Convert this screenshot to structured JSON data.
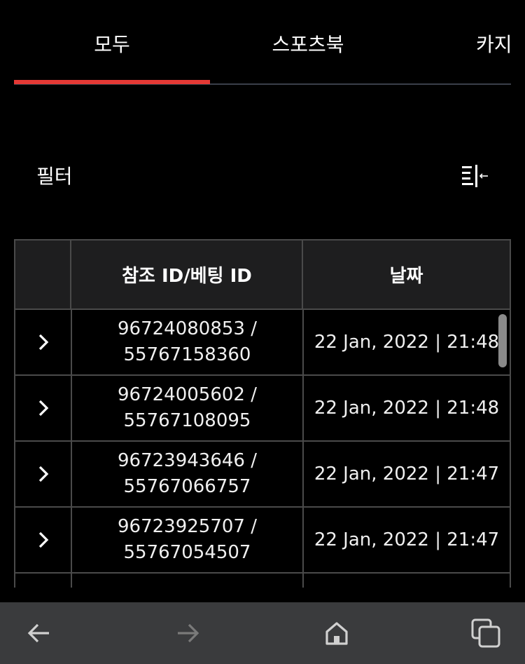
{
  "tabs": [
    {
      "label": "모두",
      "active": true
    },
    {
      "label": "스포츠북",
      "active": false
    },
    {
      "label": "카지",
      "active": false
    }
  ],
  "filter": {
    "label": "필터",
    "icon": "collapse-filter-icon"
  },
  "table": {
    "headers": {
      "expand": "",
      "ref": "참조 ID/베팅 ID",
      "date": "날짜"
    },
    "rows": [
      {
        "ref_id": "96724080853 /",
        "bet_id": "55767158360",
        "date": "22 Jan, 2022 | 21:48"
      },
      {
        "ref_id": "96724005602 /",
        "bet_id": "55767108095",
        "date": "22 Jan, 2022 | 21:48"
      },
      {
        "ref_id": "96723943646 /",
        "bet_id": "55767066757",
        "date": "22 Jan, 2022 | 21:47"
      },
      {
        "ref_id": "96723925707 /",
        "bet_id": "55767054507",
        "date": "22 Jan, 2022 | 21:47"
      }
    ]
  },
  "colors": {
    "accent": "#e53935",
    "background": "#000000",
    "header_bg": "#1e1e1f",
    "border": "#4a4a4a",
    "bottom_bar": "#3a3b3d"
  },
  "bottom_nav": {
    "back": "arrow-left-icon",
    "forward": "arrow-right-icon",
    "home": "home-icon",
    "tabs": "tabs-icon"
  }
}
